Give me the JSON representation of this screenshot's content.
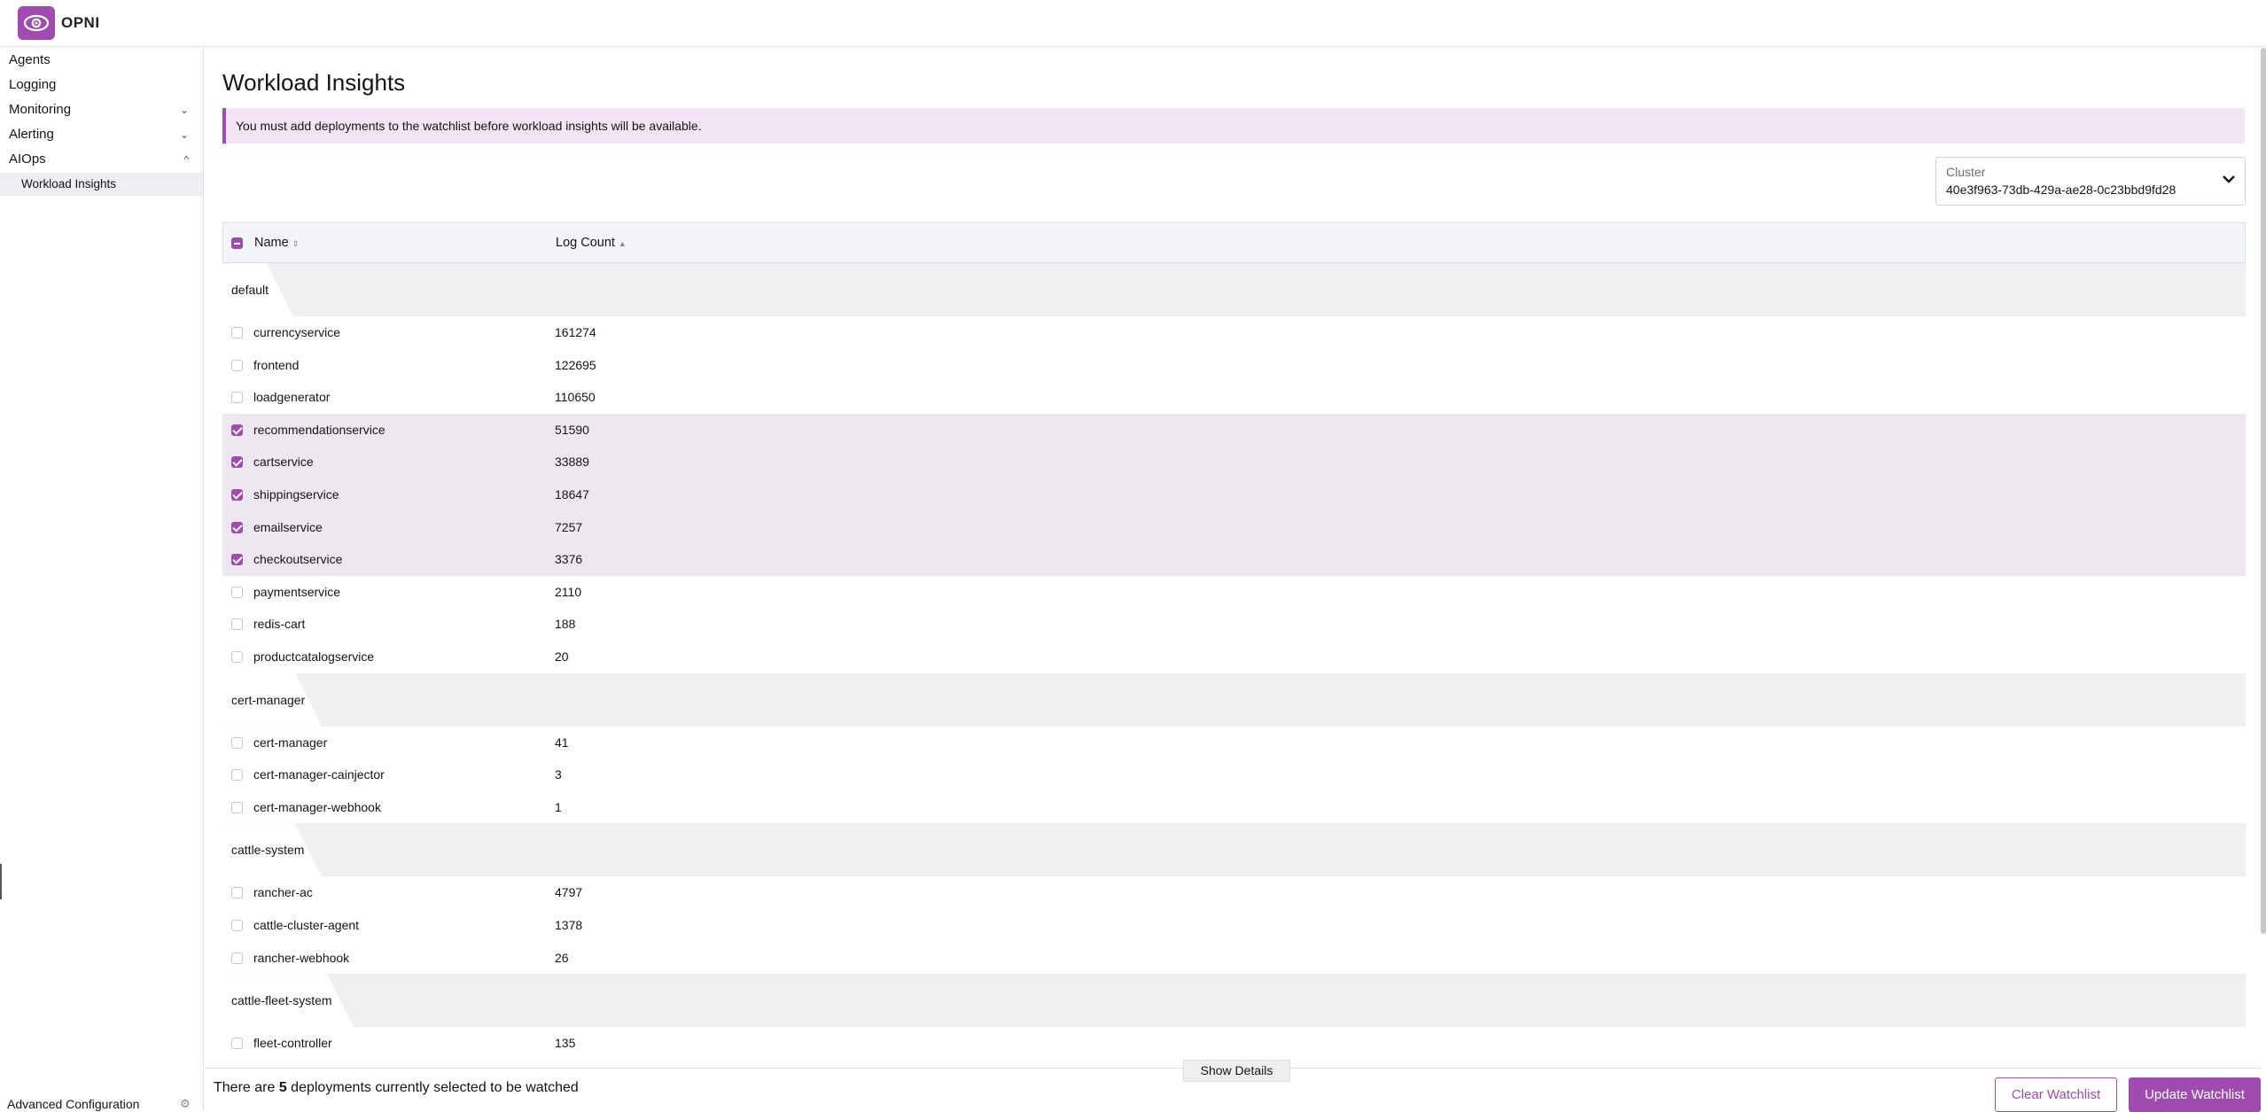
{
  "app": {
    "logo_text": "OPNI"
  },
  "sidebar": {
    "items": [
      {
        "label": "Agents",
        "chevron": ""
      },
      {
        "label": "Logging",
        "chevron": ""
      },
      {
        "label": "Monitoring",
        "chevron": "⌄"
      },
      {
        "label": "Alerting",
        "chevron": "⌄"
      },
      {
        "label": "AIOps",
        "chevron": "^"
      }
    ],
    "sub_item": "Workload Insights",
    "advanced": "Advanced Configuration"
  },
  "page": {
    "title": "Workload Insights",
    "banner": "You must add deployments to the watchlist before workload insights will be available.",
    "cluster_label": "Cluster",
    "cluster_value": "40e3f963-73db-429a-ae28-0c23bbd9fd28"
  },
  "table": {
    "col_name": "Name",
    "col_count": "Log Count",
    "groups": [
      {
        "name": "default",
        "rows": [
          {
            "name": "currencyservice",
            "count": "161274",
            "checked": false
          },
          {
            "name": "frontend",
            "count": "122695",
            "checked": false
          },
          {
            "name": "loadgenerator",
            "count": "110650",
            "checked": false
          },
          {
            "name": "recommendationservice",
            "count": "51590",
            "checked": true
          },
          {
            "name": "cartservice",
            "count": "33889",
            "checked": true
          },
          {
            "name": "shippingservice",
            "count": "18647",
            "checked": true
          },
          {
            "name": "emailservice",
            "count": "7257",
            "checked": true
          },
          {
            "name": "checkoutservice",
            "count": "3376",
            "checked": true
          },
          {
            "name": "paymentservice",
            "count": "2110",
            "checked": false
          },
          {
            "name": "redis-cart",
            "count": "188",
            "checked": false
          },
          {
            "name": "productcatalogservice",
            "count": "20",
            "checked": false
          }
        ]
      },
      {
        "name": "cert-manager",
        "rows": [
          {
            "name": "cert-manager",
            "count": "41",
            "checked": false
          },
          {
            "name": "cert-manager-cainjector",
            "count": "3",
            "checked": false
          },
          {
            "name": "cert-manager-webhook",
            "count": "1",
            "checked": false
          }
        ]
      },
      {
        "name": "cattle-system",
        "rows": [
          {
            "name": "rancher-ac",
            "count": "4797",
            "checked": false
          },
          {
            "name": "cattle-cluster-agent",
            "count": "1378",
            "checked": false
          },
          {
            "name": "rancher-webhook",
            "count": "26",
            "checked": false
          }
        ]
      },
      {
        "name": "cattle-fleet-system",
        "rows": [
          {
            "name": "fleet-controller",
            "count": "135",
            "checked": false
          }
        ]
      }
    ]
  },
  "footer": {
    "text_before": "There are ",
    "count": "5",
    "text_after": " deployments currently selected to be watched",
    "show_details": "Show Details",
    "clear": "Clear Watchlist",
    "update": "Update Watchlist"
  },
  "colors": {
    "accent": "#9f4bb0",
    "banner_bg": "#f2e4f5",
    "selected_row": "#ede8ef"
  },
  "icons": [
    "opni-logo-icon",
    "chevron-down-icon",
    "chevron-up-icon",
    "sort-icon",
    "gear-icon"
  ]
}
